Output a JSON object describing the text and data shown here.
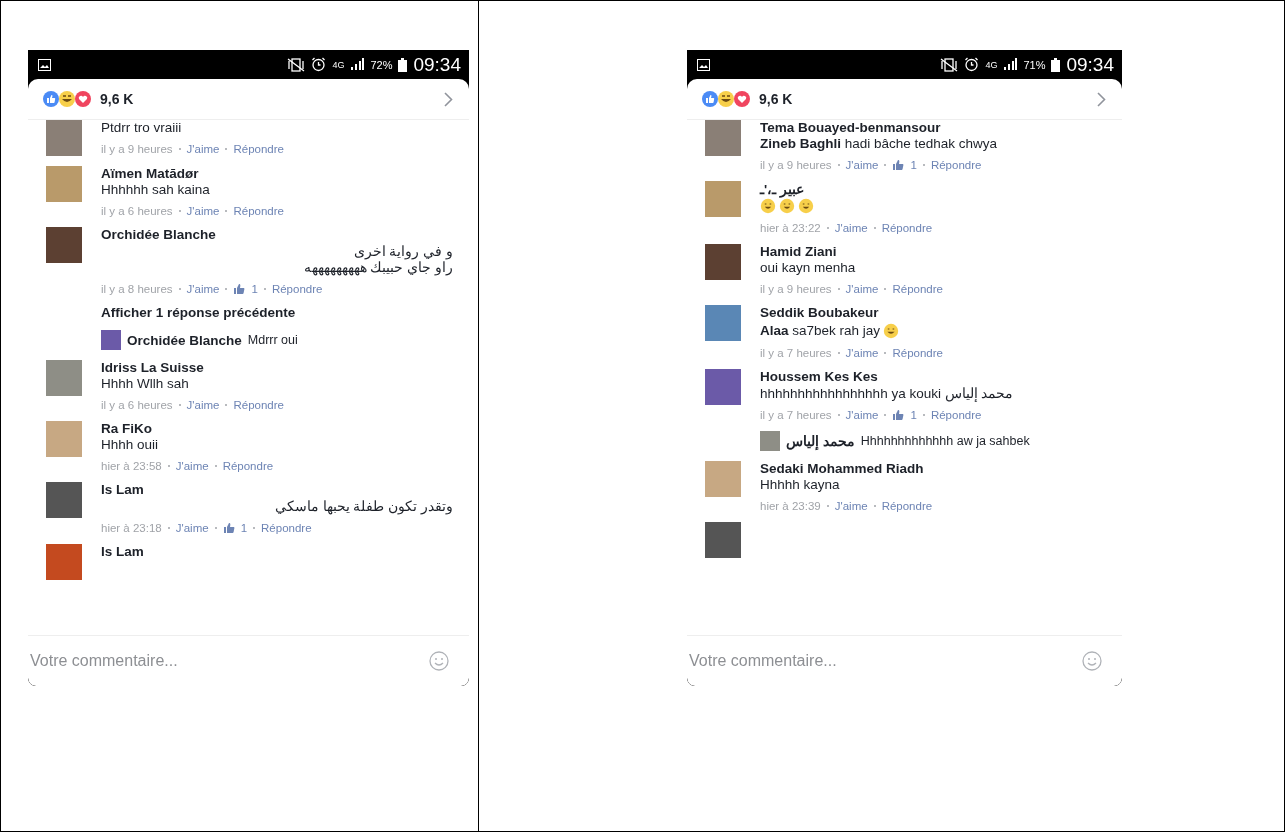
{
  "panels": [
    {
      "status_bar": {
        "network": "4G",
        "battery": "72%",
        "time": "09:34"
      },
      "reactions_count": "9,6 K",
      "comments": [
        {
          "kind": "comment",
          "text": "Ptdrr tro vraiii",
          "meta": {
            "time": "il y a 9 heures",
            "like": "J'aime",
            "reply": "Répondre"
          }
        },
        {
          "kind": "comment",
          "name": "Aïmen Matādør",
          "text": "Hhhhhh sah kaina",
          "meta": {
            "time": "il y a 6 heures",
            "like": "J'aime",
            "reply": "Répondre"
          }
        },
        {
          "kind": "comment",
          "name": "Orchidée Blanche",
          "text": "و في رواية اخرى\nراو جاي حبيبك هههههههههه",
          "rtl": true,
          "meta": {
            "time": "il y a 8 heures",
            "like": "J'aime",
            "likes": "1",
            "reply": "Répondre"
          }
        },
        {
          "kind": "more_replies",
          "label": "Afficher 1 réponse précédente"
        },
        {
          "kind": "reply",
          "name": "Orchidée Blanche",
          "text": "Mdrrr oui"
        },
        {
          "kind": "comment",
          "name": "Idriss La Suisse",
          "text": "Hhhh Wllh sah",
          "meta": {
            "time": "il y a 6 heures",
            "like": "J'aime",
            "reply": "Répondre"
          }
        },
        {
          "kind": "comment",
          "name": "Ra FiKo",
          "text": "Hhhh ouii",
          "meta": {
            "time": "hier à 23:58",
            "like": "J'aime",
            "reply": "Répondre"
          }
        },
        {
          "kind": "comment",
          "name": "Is Lam",
          "text": "وتقدر تكون طفلة يحبها ماسكي",
          "rtl": true,
          "meta": {
            "time": "hier à 23:18",
            "like": "J'aime",
            "likes": "1",
            "reply": "Répondre"
          }
        },
        {
          "kind": "comment",
          "name": "Is Lam"
        }
      ],
      "composer": {
        "placeholder": "Votre commentaire..."
      }
    },
    {
      "status_bar": {
        "network": "4G",
        "battery": "71%",
        "time": "09:34"
      },
      "reactions_count": "9,6 K",
      "comments": [
        {
          "kind": "comment",
          "name": "Tema Bouayed-benmansour",
          "text": "**Zineb Baghli** hadi bâche tedhak chwya",
          "meta": {
            "time": "il y a 9 heures",
            "like": "J'aime",
            "likes": "1",
            "reply": "Répondre"
          }
        },
        {
          "kind": "comment",
          "name": "عبير ـ،'ـ",
          "emojis": [
            {
              "kind": "laugh"
            },
            {
              "kind": "laugh"
            },
            {
              "kind": "laugh"
            }
          ],
          "meta": {
            "time": "hier à 23:22",
            "like": "J'aime",
            "reply": "Répondre"
          }
        },
        {
          "kind": "comment",
          "name": "Hamid Ziani",
          "text": "oui kayn menha",
          "meta": {
            "time": "il y a 9 heures",
            "like": "J'aime",
            "reply": "Répondre"
          }
        },
        {
          "kind": "comment",
          "name": "Seddik Boubakeur",
          "text": "**Alaa** sa7bek rah jay",
          "emojis": [
            {
              "kind": "grin"
            }
          ],
          "meta": {
            "time": "il y a 7 heures",
            "like": "J'aime",
            "reply": "Répondre"
          }
        },
        {
          "kind": "comment",
          "name": "Houssem Kes Kes",
          "text": "hhhhhhhhhhhhhhhhh ya kouki محمد إلياس",
          "meta": {
            "time": "il y a 7 heures",
            "like": "J'aime",
            "likes": "1",
            "reply": "Répondre"
          }
        },
        {
          "kind": "reply",
          "name": "محمد إلياس",
          "text": "Hhhhhhhhhhhhh aw ja sahbek"
        },
        {
          "kind": "comment",
          "name": "Sedaki Mohammed Riadh",
          "text": "Hhhhh kayna",
          "meta": {
            "time": "hier à 23:39",
            "like": "J'aime",
            "reply": "Répondre"
          }
        },
        {
          "kind": "comment"
        }
      ],
      "composer": {
        "placeholder": "Votre commentaire..."
      }
    }
  ]
}
